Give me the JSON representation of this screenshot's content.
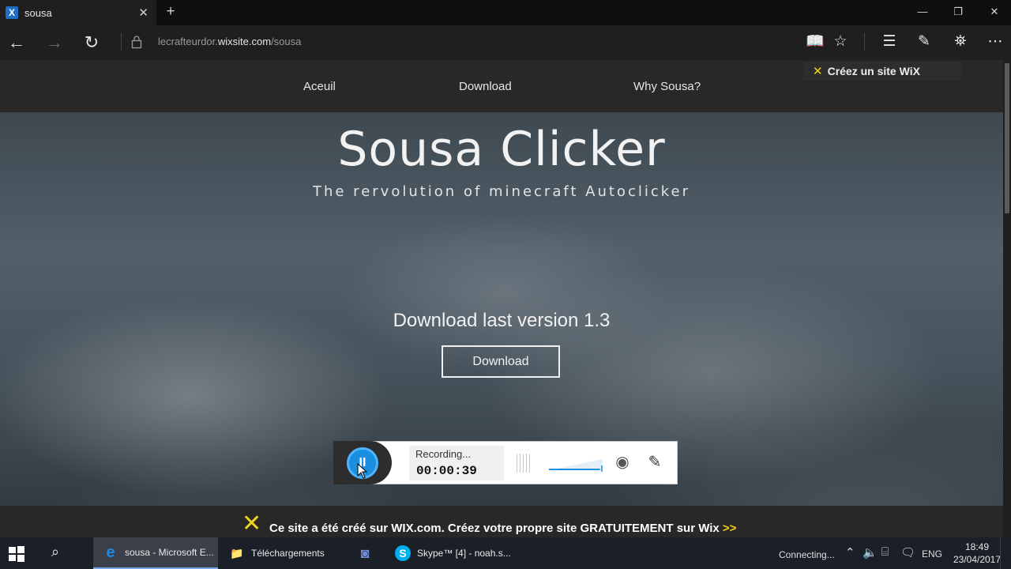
{
  "browser": {
    "tab": {
      "title": "sousa",
      "favicon_letter": "X",
      "close": "✕",
      "new_tab": "+"
    },
    "window_controls": {
      "minimize": "—",
      "maximize": "❐",
      "close": "✕"
    },
    "nav": {
      "back": "←",
      "forward": "→",
      "refresh": "↻"
    },
    "url": {
      "prefix": "lecrafteurdor.",
      "domain": "wixsite.com",
      "path": "/sousa"
    },
    "tools": {
      "reading": "📖",
      "favorite": "☆",
      "hub": "☰",
      "notes": "✎",
      "share": "⛯",
      "more": "⋯"
    }
  },
  "site": {
    "nav": [
      "Aceuil",
      "Download",
      "Why Sousa?"
    ],
    "wix_create": {
      "mark": "✕",
      "label": "Créez un site WiX"
    },
    "hero": {
      "title": "Sousa Clicker",
      "subtitle": "The rervolution of minecraft Autoclicker",
      "download_text": "Download last version 1.3",
      "download_button": "Download"
    },
    "banner": {
      "logo": "✕",
      "text": "Ce site a été créé sur WIX.com. Créez votre propre site GRATUITEMENT sur Wix ",
      "arrow": ">>"
    }
  },
  "recorder": {
    "pause_symbol": "II",
    "status": "Recording...",
    "time": "00:00:39",
    "webcam": "◉",
    "pen": "✎",
    "volume_level": 0.95
  },
  "taskbar": {
    "search": "⌕",
    "items": [
      {
        "label": "sousa - Microsoft E...",
        "icon": "e",
        "icon_color": "#1e88e5",
        "active": true
      },
      {
        "label": "Téléchargements",
        "icon": "📁",
        "icon_color": "#f2c744",
        "active": false
      },
      {
        "label": "",
        "icon": "◙",
        "icon_color": "#7289da",
        "active": false
      },
      {
        "label": "Skype™ [4] - noah.s...",
        "icon": "S",
        "icon_color": "#00aff0",
        "active": false
      }
    ],
    "tray": {
      "connecting": "Connecting...",
      "chevron": "⌃",
      "speaker": "🔈",
      "network": "⌸",
      "message": "🗨",
      "lang": "ENG",
      "time": "18:49",
      "date": "23/04/2017"
    }
  }
}
